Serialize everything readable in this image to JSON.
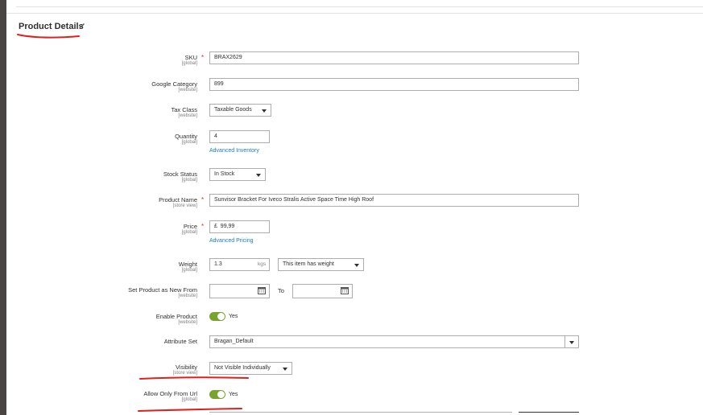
{
  "section": {
    "title": "Product Details",
    "edit_icon": "pencil-icon"
  },
  "fields": {
    "sku": {
      "label": "SKU",
      "scope": "[global]",
      "value": "BRAX2629"
    },
    "google_category": {
      "label": "Google Category",
      "scope": "[website]",
      "value": "899"
    },
    "tax_class": {
      "label": "Tax Class",
      "scope": "[website]",
      "value": "Taxable Goods"
    },
    "quantity": {
      "label": "Quantity",
      "scope": "[global]",
      "value": "4",
      "link": "Advanced Inventory"
    },
    "stock_status": {
      "label": "Stock Status",
      "scope": "[global]",
      "value": "In Stock"
    },
    "product_name": {
      "label": "Product Name",
      "scope": "[store view]",
      "value": "Sunvisor Bracket For Iveco Stralis Active Space Time High Roof"
    },
    "price": {
      "label": "Price",
      "scope": "[global]",
      "currency": "£",
      "value": "99,99",
      "link": "Advanced Pricing"
    },
    "weight": {
      "label": "Weight",
      "scope": "[global]",
      "value": "1.3",
      "unit": "kgs",
      "has_weight": "This item has weight"
    },
    "new_from": {
      "label": "Set Product as New From",
      "scope": "[website]",
      "to_label": "To",
      "from_value": "",
      "to_value": ""
    },
    "enable_product": {
      "label": "Enable Product",
      "scope": "[website]",
      "state": "Yes"
    },
    "attribute_set": {
      "label": "Attribute Set",
      "value": "Bragan_Default"
    },
    "visibility": {
      "label": "Visibility",
      "scope": "[store view]",
      "value": "Not Visible Individually"
    },
    "allow_only_from_url": {
      "label": "Allow Only From Url",
      "scope": "[global]",
      "state": "Yes"
    }
  },
  "colors": {
    "toggle_on": "#79a22e",
    "link": "#1979c3",
    "required": "#e22626",
    "annotation": "#e0201c"
  }
}
